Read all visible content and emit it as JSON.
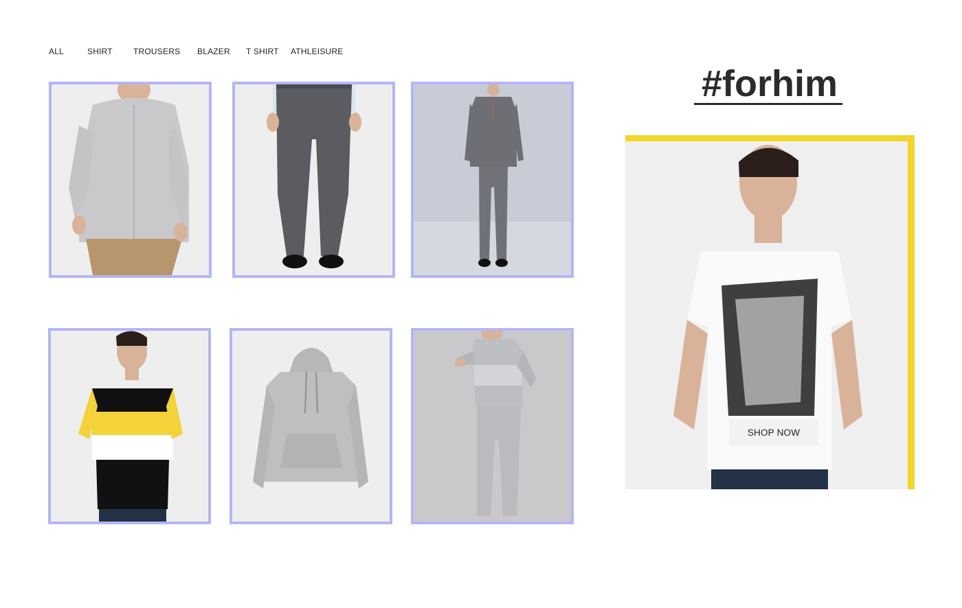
{
  "filters": {
    "tabs": [
      {
        "label": "ALL"
      },
      {
        "label": "SHIRT"
      },
      {
        "label": "TROUSERS"
      },
      {
        "label": "BLAZER"
      },
      {
        "label": "T SHIRT"
      },
      {
        "label": "ATHLEISURE"
      }
    ]
  },
  "products": [
    {
      "image": "grey-shirt-photo"
    },
    {
      "image": "grey-trousers-photo"
    },
    {
      "image": "grey-suit-photo"
    },
    {
      "image": "striped-tshirt-photo"
    },
    {
      "image": "grey-hoodie-photo"
    },
    {
      "image": "grey-tracksuit-photo"
    }
  ],
  "promo": {
    "title": "#forhim",
    "image": "white-graphic-tshirt-photo",
    "button_label": "SHOP NOW"
  },
  "colors": {
    "tile_border": "#b3b6f5",
    "promo_frame": "#f2d62a",
    "title_text": "#2b2b2b"
  }
}
